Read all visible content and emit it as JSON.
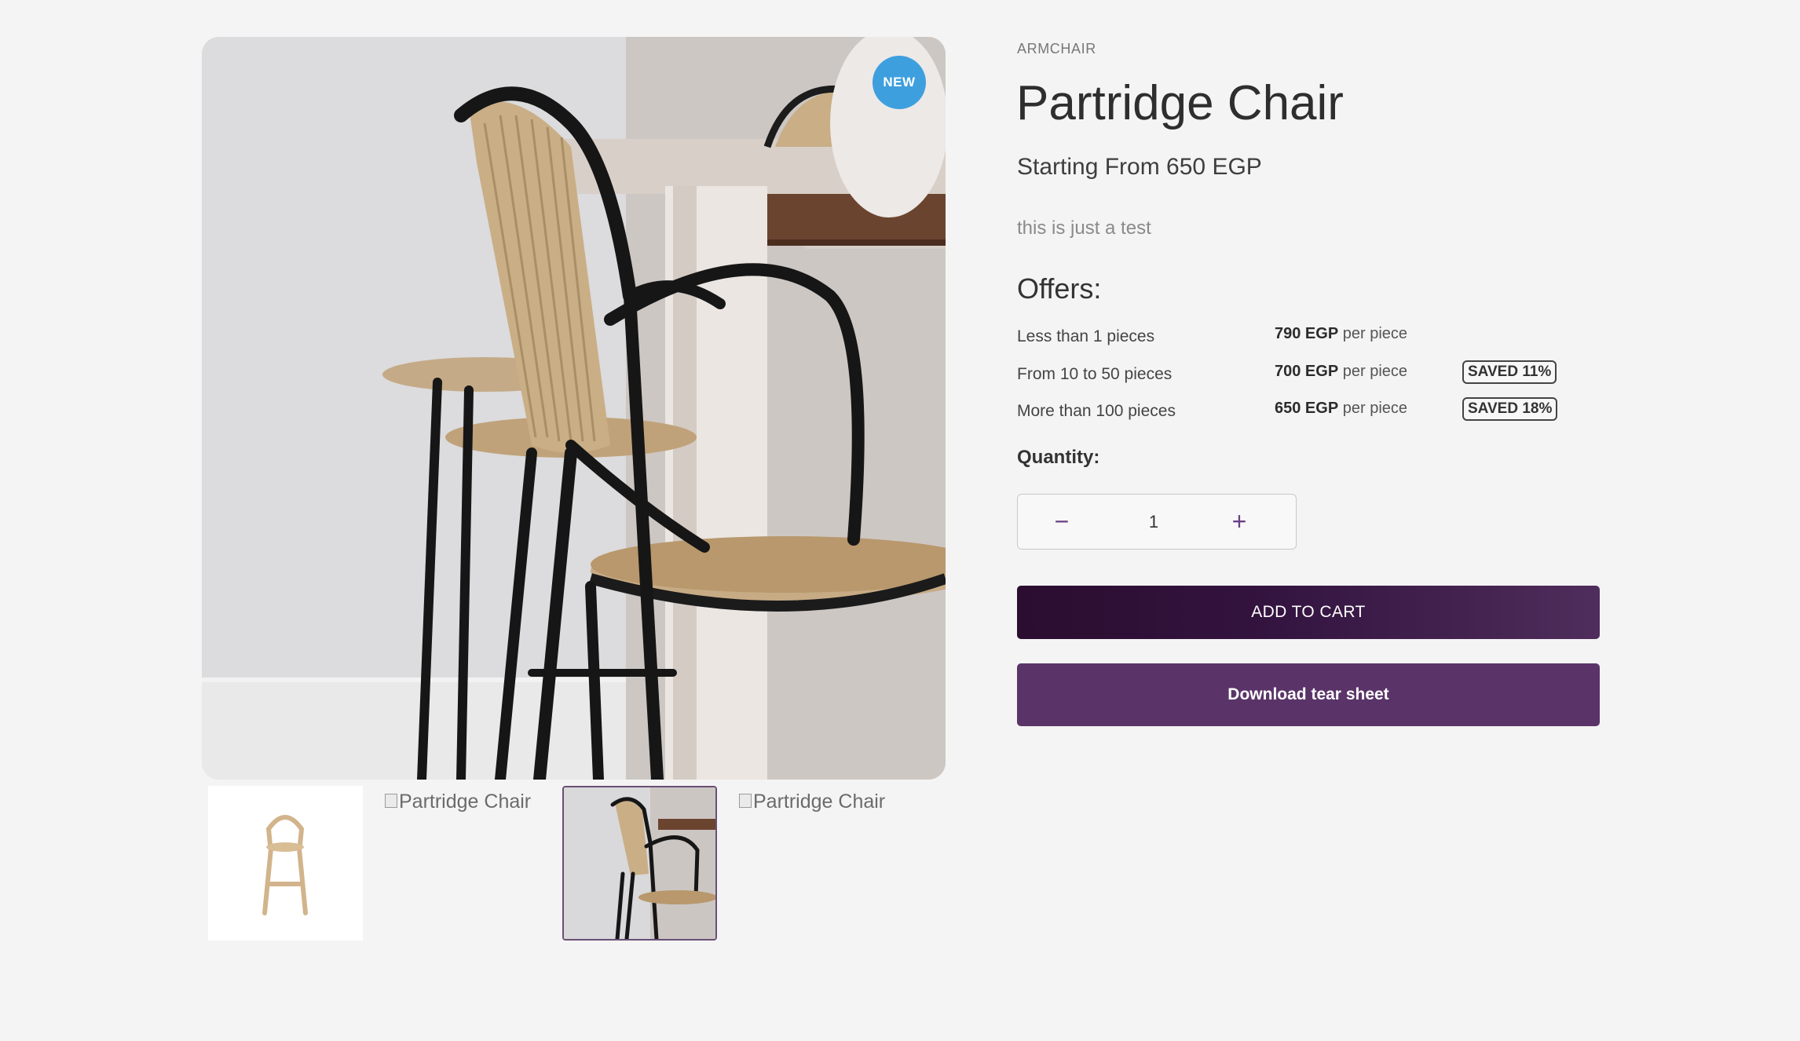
{
  "product": {
    "category": "ARMCHAIR",
    "title": "Partridge Chair",
    "price_text": "Starting From 650 EGP",
    "description": "this is just a test",
    "badge": "NEW"
  },
  "gallery": {
    "thumb_alt_2": "Partridge Chair",
    "thumb_alt_4": "Partridge Chair",
    "selected_thumb": 3
  },
  "offers": {
    "heading": "Offers:",
    "rows": [
      {
        "label": "Less than 1 pieces",
        "price": "790 EGP",
        "unit": "per piece",
        "saved": ""
      },
      {
        "label": "From 10 to 50 pieces",
        "price": "700 EGP",
        "unit": "per piece",
        "saved": "SAVED 11%"
      },
      {
        "label": "More than 100 pieces",
        "price": "650 EGP",
        "unit": "per piece",
        "saved": "SAVED 18%"
      }
    ]
  },
  "quantity": {
    "label": "Quantity:",
    "value": "1",
    "minus": "−",
    "plus": "+"
  },
  "actions": {
    "add_to_cart": "ADD TO CART",
    "download": "Download tear sheet"
  },
  "colors": {
    "badge": "#3e9fde",
    "cart_button": "#2a0d2f",
    "download_button": "#5a3468",
    "accent": "#6a3f86"
  }
}
